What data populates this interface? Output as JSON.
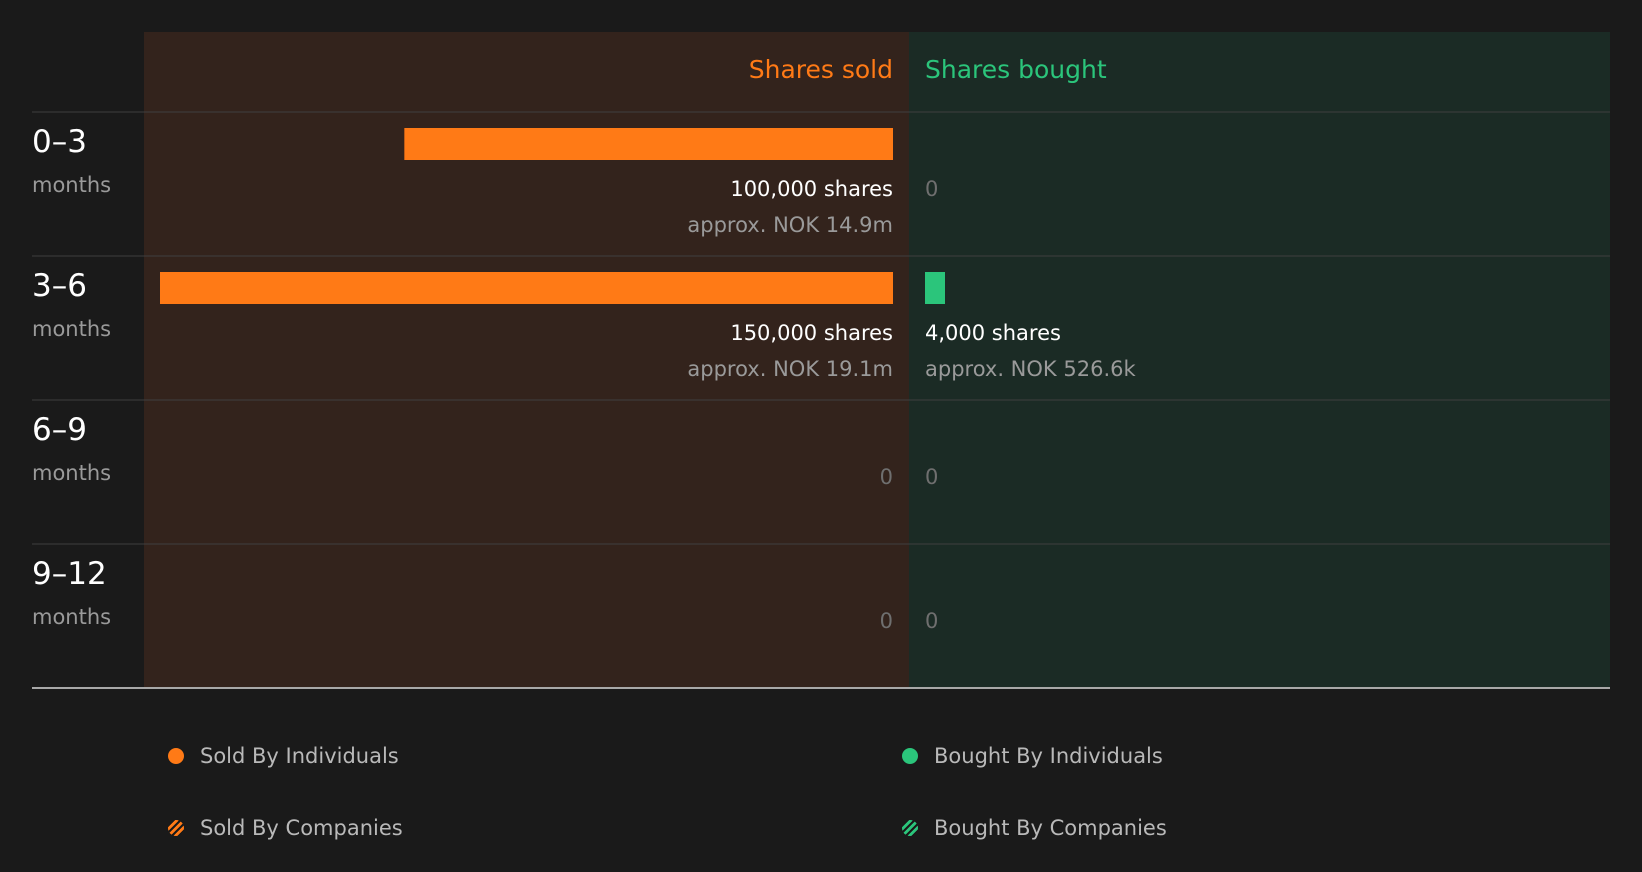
{
  "colors": {
    "background": "#1a1a1a",
    "sold_panel": "#33231c",
    "bought_panel": "#1b2b25",
    "sold": "#ff7a16",
    "bought": "#2bc57b",
    "row_label": "#ffffff",
    "row_sub": "#9a9a9a",
    "value_text": "#ffffff",
    "approx_text": "#9a9a9a",
    "zero_text": "#6f6f6f",
    "divider": "#3f3f3f",
    "baseline": "#a8a8a8"
  },
  "chart_data": {
    "type": "bar",
    "orientation": "horizontal-diverging",
    "columns": {
      "sold": "Shares sold",
      "bought": "Shares bought"
    },
    "rows": [
      {
        "label": "0–3",
        "sublabel": "months",
        "sold": {
          "value": 100000,
          "label": "100,000 shares",
          "approx": "approx. NOK 14.9m"
        },
        "bought": {
          "value": 0,
          "label": "0",
          "approx": ""
        }
      },
      {
        "label": "3–6",
        "sublabel": "months",
        "sold": {
          "value": 150000,
          "label": "150,000 shares",
          "approx": "approx. NOK 19.1m"
        },
        "bought": {
          "value": 4000,
          "label": "4,000 shares",
          "approx": "approx. NOK 526.6k"
        }
      },
      {
        "label": "6–9",
        "sublabel": "months",
        "sold": {
          "value": 0,
          "label": "0",
          "approx": ""
        },
        "bought": {
          "value": 0,
          "label": "0",
          "approx": ""
        }
      },
      {
        "label": "9–12",
        "sublabel": "months",
        "sold": {
          "value": 0,
          "label": "0",
          "approx": ""
        },
        "bought": {
          "value": 0,
          "label": "0",
          "approx": ""
        }
      }
    ],
    "xlim": [
      0,
      150000
    ],
    "legend_position": "bottom",
    "legend": [
      {
        "label": "Sold By Individuals",
        "style": "solid",
        "color": "#ff7a16"
      },
      {
        "label": "Bought By Individuals",
        "style": "solid",
        "color": "#2bc57b"
      },
      {
        "label": "Sold By Companies",
        "style": "hatched",
        "color": "#ff7a16"
      },
      {
        "label": "Bought By Companies",
        "style": "hatched",
        "color": "#2bc57b"
      }
    ]
  }
}
